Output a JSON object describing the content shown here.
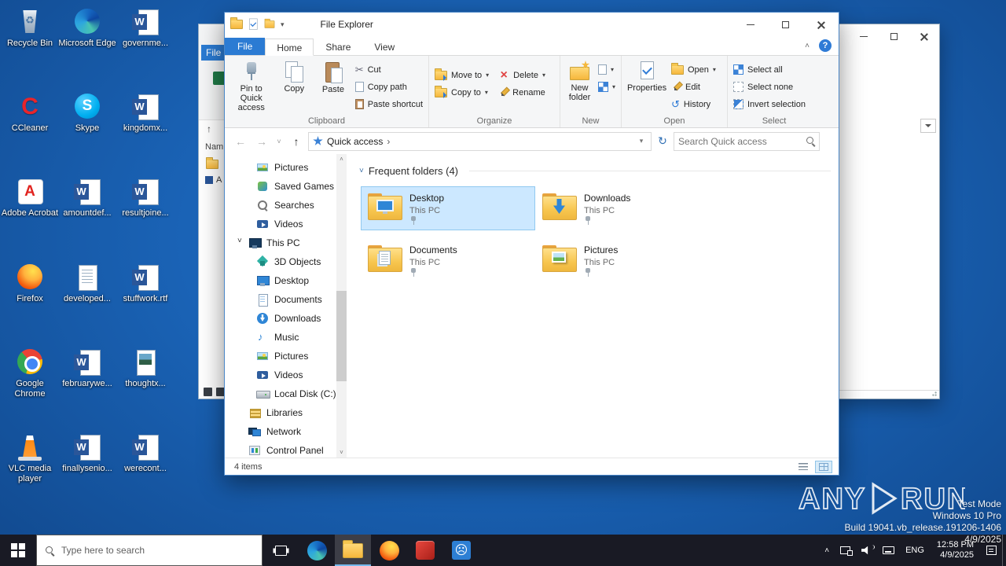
{
  "colors": {
    "accent": "#2b7bd3",
    "selection_fill": "#cce8ff",
    "desktop_blue": "#1a63b6",
    "taskbar": "#191a24"
  },
  "glyphs": {
    "back": "←",
    "forward": "→",
    "up": "↑",
    "refresh": "↻",
    "history": "↺",
    "dropdown": "▾",
    "chevron_right": "›",
    "chevron_down": "˅",
    "chevron_up": "˄",
    "scissors": "✂",
    "delete_x": "×",
    "help": "?",
    "sad_face": "☹"
  },
  "desktop": {
    "icons": [
      {
        "label": "Recycle Bin",
        "type": "recycle"
      },
      {
        "label": "Microsoft Edge",
        "type": "edge"
      },
      {
        "label": "governme...",
        "type": "word"
      },
      {
        "label": "CCleaner",
        "type": "ccleaner"
      },
      {
        "label": "Skype",
        "type": "skype"
      },
      {
        "label": "kingdomx...",
        "type": "word"
      },
      {
        "label": "Adobe Acrobat",
        "type": "acrobat"
      },
      {
        "label": "amountdef...",
        "type": "word"
      },
      {
        "label": "resultjoine...",
        "type": "word"
      },
      {
        "label": "Firefox",
        "type": "firefox"
      },
      {
        "label": "developed...",
        "type": "notepad"
      },
      {
        "label": "stuffwork.rtf",
        "type": "word"
      },
      {
        "label": "Google Chrome",
        "type": "chrome"
      },
      {
        "label": "februarywe...",
        "type": "word"
      },
      {
        "label": "thoughtx...",
        "type": "image"
      },
      {
        "label": "VLC media player",
        "type": "vlc"
      },
      {
        "label": "finallysenio...",
        "type": "word"
      },
      {
        "label": "werecont...",
        "type": "word"
      }
    ]
  },
  "explorer": {
    "title": "File Explorer",
    "menu_tabs": {
      "file": "File",
      "home": "Home",
      "share": "Share",
      "view": "View"
    },
    "ribbon": {
      "pin": "Pin to Quick access",
      "copy": "Copy",
      "paste": "Paste",
      "cut": "Cut",
      "copy_path": "Copy path",
      "paste_shortcut": "Paste shortcut",
      "move_to": "Move to",
      "copy_to": "Copy to",
      "delete": "Delete",
      "rename": "Rename",
      "new_folder": "New folder",
      "properties": "Properties",
      "open": "Open",
      "edit": "Edit",
      "history": "History",
      "select_all": "Select all",
      "select_none": "Select none",
      "invert_selection": "Invert selection",
      "groups": {
        "clipboard": "Clipboard",
        "organize": "Organize",
        "new": "New",
        "open": "Open",
        "select": "Select"
      }
    },
    "nav": {
      "breadcrumb_root": "Quick access",
      "search_placeholder": "Search Quick access"
    },
    "sidebar": {
      "items": [
        {
          "label": "Pictures"
        },
        {
          "label": "Saved Games"
        },
        {
          "label": "Searches"
        },
        {
          "label": "Videos"
        },
        {
          "label": "This PC"
        },
        {
          "label": "3D Objects"
        },
        {
          "label": "Desktop"
        },
        {
          "label": "Documents"
        },
        {
          "label": "Downloads"
        },
        {
          "label": "Music"
        },
        {
          "label": "Pictures"
        },
        {
          "label": "Videos"
        },
        {
          "label": "Local Disk (C:)"
        },
        {
          "label": "Libraries"
        },
        {
          "label": "Network"
        },
        {
          "label": "Control Panel"
        }
      ]
    },
    "content": {
      "section_title": "Frequent folders (4)",
      "tiles": [
        {
          "name": "Desktop",
          "location": "This PC"
        },
        {
          "name": "Downloads",
          "location": "This PC"
        },
        {
          "name": "Documents",
          "location": "This PC"
        },
        {
          "name": "Pictures",
          "location": "This PC"
        }
      ]
    },
    "status": {
      "items_count": "4 items"
    }
  },
  "background_left": {
    "file_tab": "File",
    "column_header": "Nam",
    "item_label": "A"
  },
  "watermark": {
    "brand_left": "ANY",
    "brand_right": "RUN",
    "line1": "Test Mode",
    "line2": "Windows 10 Pro",
    "line3": "Build 19041.vb_release.191206-1406",
    "line4": "4/9/2025"
  },
  "taskbar": {
    "search_placeholder": "Type here to search",
    "language": "ENG",
    "time": "12:58 PM",
    "date": "4/9/2025"
  }
}
